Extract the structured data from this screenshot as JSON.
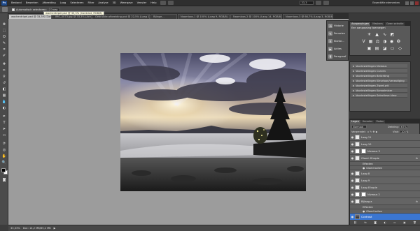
{
  "menubar": {
    "logo": "Ps",
    "items": [
      "Bestand",
      "Bewerken",
      "Afbeelding",
      "Laag",
      "Selecteren",
      "Filter",
      "Analyse",
      "3D",
      "Weergave",
      "Venster",
      "Help"
    ],
    "zoom": "33,3",
    "workspace": "Essentiële elementen"
  },
  "options": {
    "auto_select_label": "Automatisch selecteren:",
    "auto_select_value": "Groep",
    "tooltip": "wochentripel.psd @ 33,3% (Contrast, RGB/8)"
  },
  "tabs": [
    {
      "label": "wochentripel.psd @ 33,3% (Contrast, RGB/8) ×",
      "active": true
    },
    {
      "label": "IMG_0073.jpg @ 33,3% (Achtergrond...",
      "active": false
    },
    {
      "label": "Gebruikte afbeelding.psd @ 22,5% (Laag 16 kopie, RGB/8) ×",
      "active": false
    },
    {
      "label": "Bijlage...",
      "active": false
    },
    {
      "label": "Naamloos-1 @ 100% (Laag 9, RGB/8) ×",
      "active": false
    },
    {
      "label": "Naamloos-2 @ 100% (Laag 14, RGB/8) ×",
      "active": false
    },
    {
      "label": "Naamloos-3 @ 66,7% (Laag 3, RGB/8) ×",
      "active": false
    }
  ],
  "actions_dock": [
    {
      "icon": "history-icon",
      "label": "Historie"
    },
    {
      "icon": "brushes-icon",
      "label": "Penselen"
    },
    {
      "icon": "clone-source-icon",
      "label": "Klonbr..."
    },
    {
      "icon": "actions-icon",
      "label": "Acties"
    },
    {
      "icon": "paragraph-icon",
      "label": "Paragraaf"
    }
  ],
  "adjustments": {
    "tabs": [
      "Aanpassingen",
      "Maskers",
      "Geen selectie"
    ],
    "title": "Een aanpassing toevoegen"
  },
  "presets": [
    "Voorinstellingen Niveaus",
    "Voorinstellingen Curven",
    "Voorinstellingen Belichting",
    "Voorinstellingen Kleurtoon/verzadiging",
    "Voorinstellingen Zwart-wit",
    "Voorinstellingen Kanaalmixer",
    "Voorinstellingen Selectieve kleur"
  ],
  "layers": {
    "tabs": [
      "Lagen",
      "Kanalen",
      "Paden"
    ],
    "blend_mode": "Normaal",
    "opacity_label": "Dekking:",
    "opacity": "67%",
    "fill_label": "Vlak:",
    "fill": "100%",
    "lock_label": "Vergrendel:",
    "rows": [
      {
        "name": "Laag 11",
        "type": "layer",
        "eye": true,
        "selected": false,
        "fx": false
      },
      {
        "name": "Laag 10",
        "type": "layer",
        "eye": true,
        "selected": false,
        "fx": false
      },
      {
        "name": "Niveaus 3",
        "type": "adjustment",
        "eye": true,
        "selected": false,
        "fx": false
      },
      {
        "name": "Gloed: 8 kopie",
        "type": "layer",
        "eye": true,
        "selected": false,
        "fx": true
      },
      {
        "name": "Effecten",
        "type": "sub",
        "eye": false,
        "selected": false,
        "fx": false
      },
      {
        "name": "Gloed buiten",
        "type": "sub",
        "eye": false,
        "selected": false,
        "fx": false
      },
      {
        "name": "Laag 8",
        "type": "layer",
        "eye": true,
        "selected": false,
        "fx": false
      },
      {
        "name": "Laag 9",
        "type": "layer",
        "eye": true,
        "selected": false,
        "fx": false
      },
      {
        "name": "Laag 8 kopie",
        "type": "layer",
        "eye": true,
        "selected": false,
        "fx": false
      },
      {
        "name": "Niveaus 2",
        "type": "adjustment",
        "eye": true,
        "selected": false,
        "fx": false
      },
      {
        "name": "Bijlaag a",
        "type": "layer",
        "eye": true,
        "selected": false,
        "fx": true
      },
      {
        "name": "Effecten",
        "type": "sub",
        "eye": false,
        "selected": false,
        "fx": false
      },
      {
        "name": "Gloed buiten",
        "type": "sub",
        "eye": false,
        "selected": false,
        "fx": false
      },
      {
        "name": "Contrast",
        "type": "photo",
        "eye": true,
        "selected": true,
        "fx": false
      }
    ]
  },
  "status": {
    "zoom": "33,33%",
    "doc": "Doc: 14,2 MB/85,2 MB"
  },
  "colors": {
    "accent": "#3b76d1",
    "tooltip_bg": "#fffde0"
  }
}
